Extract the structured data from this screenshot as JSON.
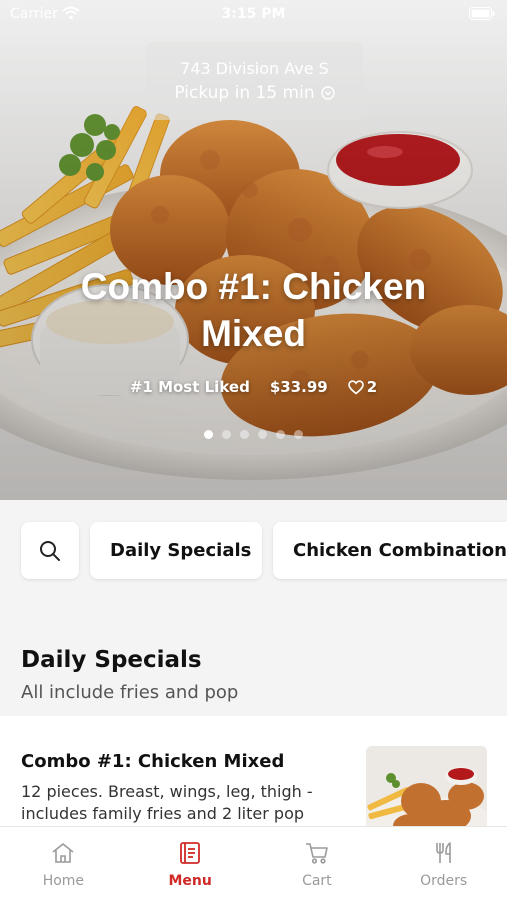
{
  "status_bar": {
    "carrier": "Carrier",
    "time": "3:15 PM"
  },
  "location": {
    "address": "743 Division Ave S",
    "pickup": "Pickup in 15 min"
  },
  "hero": {
    "title": "Combo #1: Chicken Mixed",
    "tag": "#1 Most Liked",
    "price": "$33.99",
    "likes": "2",
    "slide_count": 6,
    "active_slide": 1
  },
  "categories": {
    "chips": [
      "Daily Specials",
      "Chicken Combinations"
    ]
  },
  "section": {
    "title": "Daily Specials",
    "subtitle": "All include fries and pop"
  },
  "item": {
    "title": "Combo #1: Chicken Mixed",
    "description": "12 pieces. Breast, wings, leg, thigh - includes family fries and 2 liter pop"
  },
  "tabs": [
    {
      "label": "Home",
      "icon": "home-icon"
    },
    {
      "label": "Menu",
      "icon": "menu-icon",
      "active": true
    },
    {
      "label": "Cart",
      "icon": "cart-icon"
    },
    {
      "label": "Orders",
      "icon": "fork-knife-icon"
    }
  ],
  "colors": {
    "accent": "#cf2a27",
    "inactive": "#9a9a9a"
  }
}
